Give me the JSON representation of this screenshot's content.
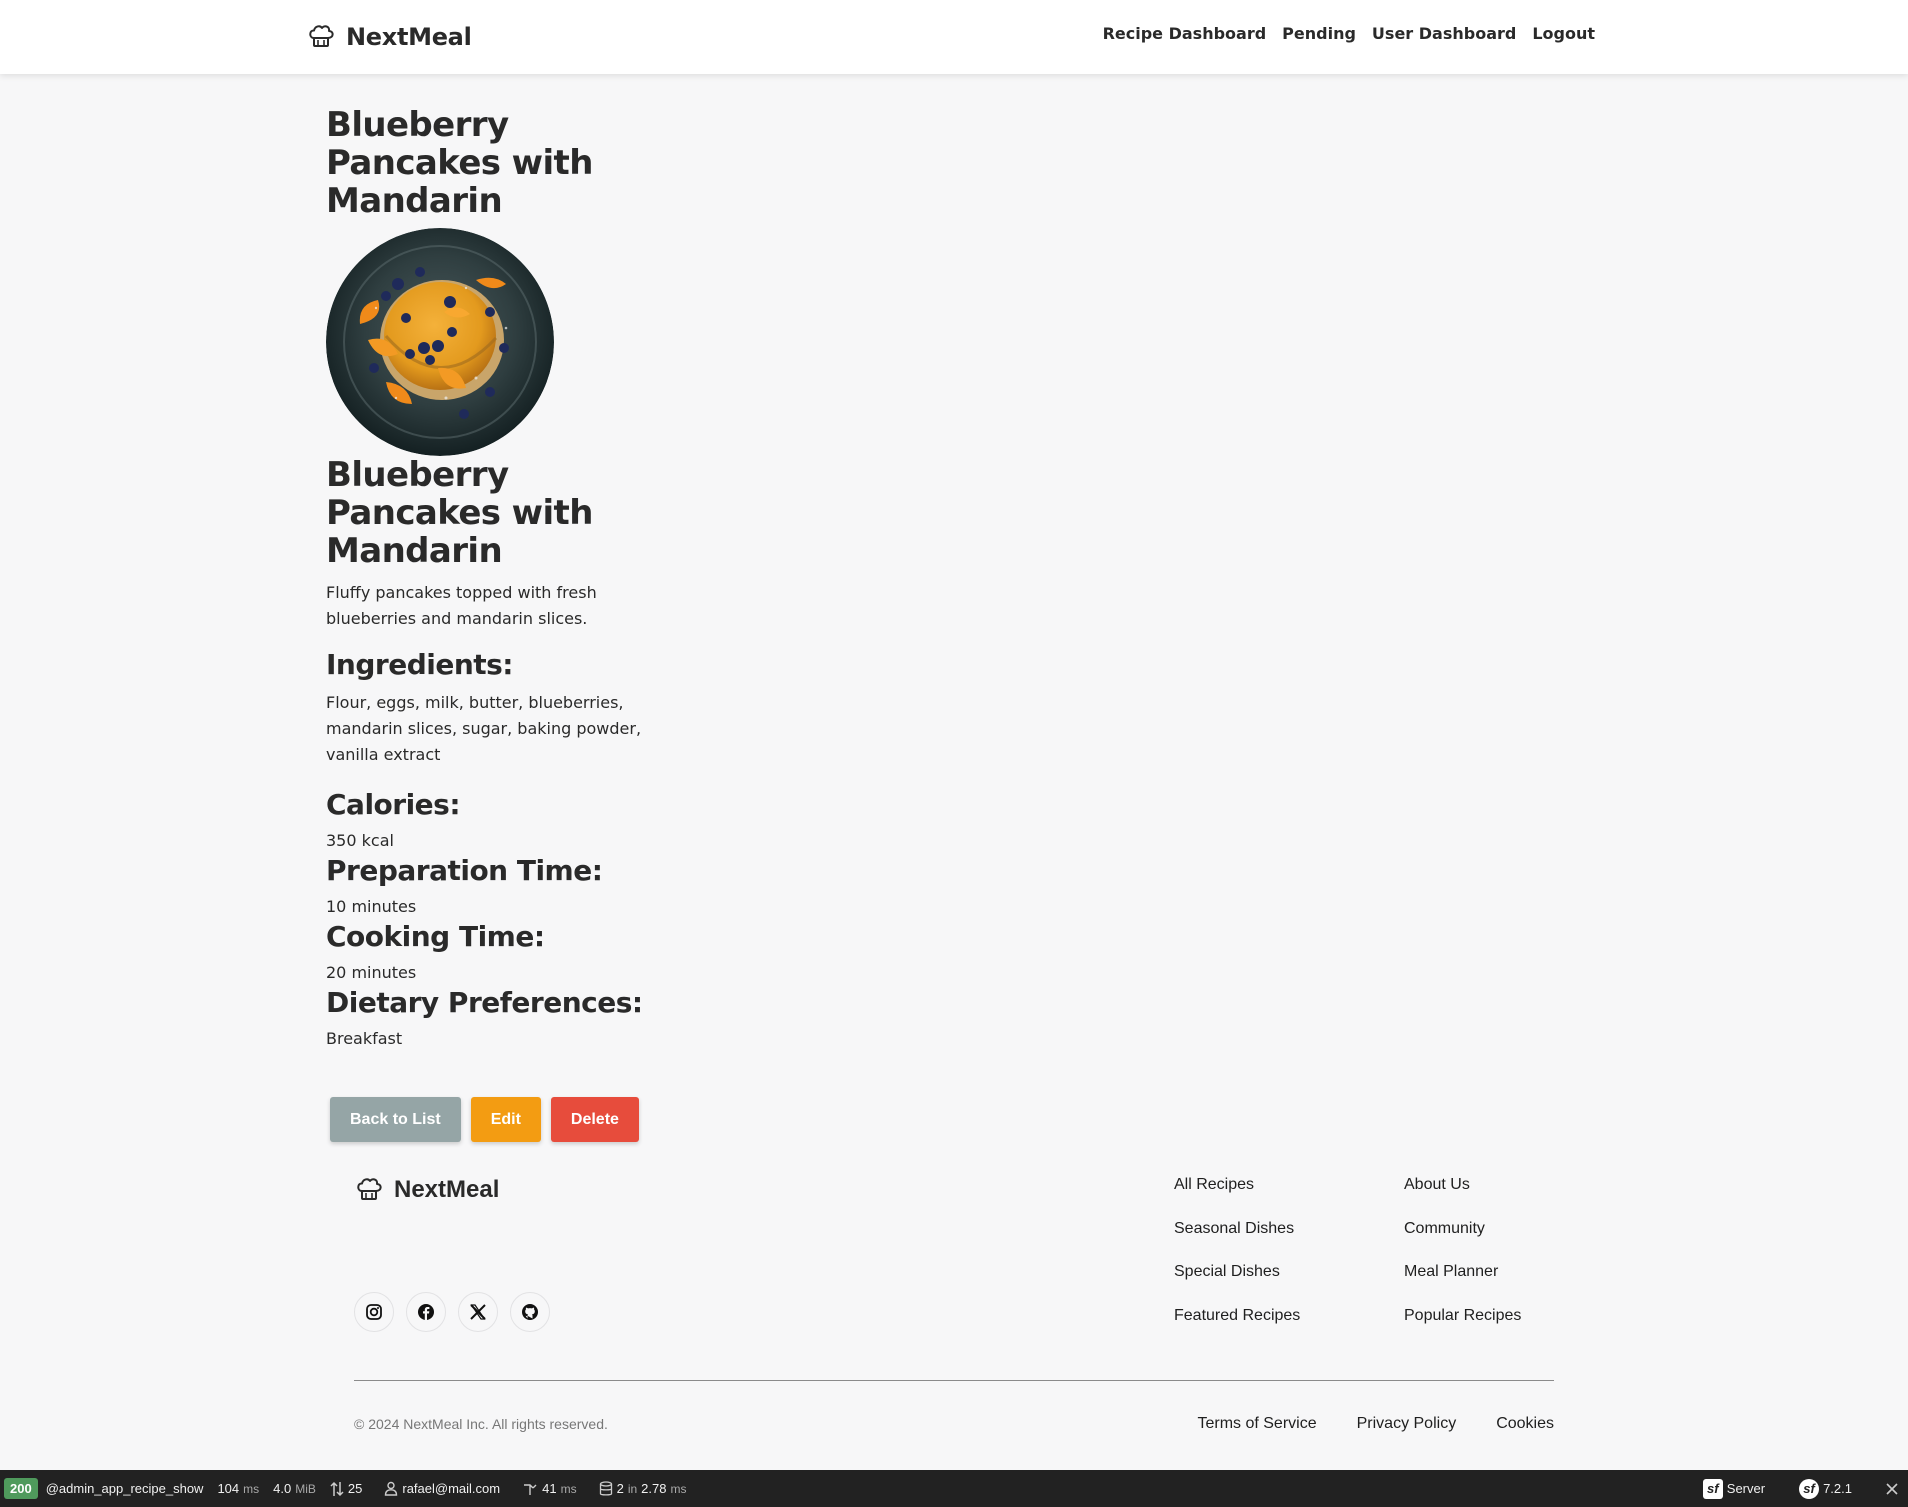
{
  "header": {
    "brand": "NextMeal",
    "nav": [
      "Recipe Dashboard",
      "Pending",
      "User Dashboard",
      "Logout"
    ]
  },
  "recipe": {
    "page_title": "Blueberry Pancakes with Mandarin",
    "title": "Blueberry Pancakes with Mandarin",
    "description": "Fluffy pancakes topped with fresh blueberries and mandarin slices.",
    "ingredients_label": "Ingredients:",
    "ingredients": "Flour, eggs, milk, butter, blueberries, mandarin slices, sugar, baking powder, vanilla extract",
    "calories_label": "Calories:",
    "calories": "350 kcal",
    "prep_label": "Preparation Time:",
    "prep": "10 minutes",
    "cook_label": "Cooking Time:",
    "cook": "20 minutes",
    "diet_label": "Dietary Preferences:",
    "diet": "Breakfast"
  },
  "actions": {
    "back": "Back to List",
    "edit": "Edit",
    "delete": "Delete"
  },
  "footer": {
    "brand": "NextMeal",
    "col1": [
      "All Recipes",
      "Seasonal Dishes",
      "Special Dishes",
      "Featured Recipes"
    ],
    "col2": [
      "About Us",
      "Community",
      "Meal Planner",
      "Popular Recipes"
    ],
    "socials": [
      "instagram-icon",
      "facebook-icon",
      "x-icon",
      "github-icon"
    ],
    "copyright": "© 2024 NextMeal Inc. All rights reserved.",
    "legal": [
      "Terms of Service",
      "Privacy Policy",
      "Cookies"
    ]
  },
  "toolbar": {
    "status": "200",
    "route": "@admin_app_recipe_show",
    "time": "104",
    "time_unit": "ms",
    "memory": "4.0",
    "memory_unit": "MiB",
    "requests": "25",
    "user": "rafael@mail.com",
    "perf": "41",
    "perf_unit": "ms",
    "db_count": "2",
    "db_in": "in",
    "db_time": "2.78",
    "db_unit": "ms",
    "server": "Server",
    "version": "7.2.1"
  },
  "colors": {
    "background": "#f7f7f8",
    "text": "#2a2a2a",
    "back_button": "#95a5a6",
    "edit_button": "#f39c12",
    "delete_button": "#e74c3c",
    "status_ok": "#4f9a5c",
    "toolbar": "#222222"
  }
}
